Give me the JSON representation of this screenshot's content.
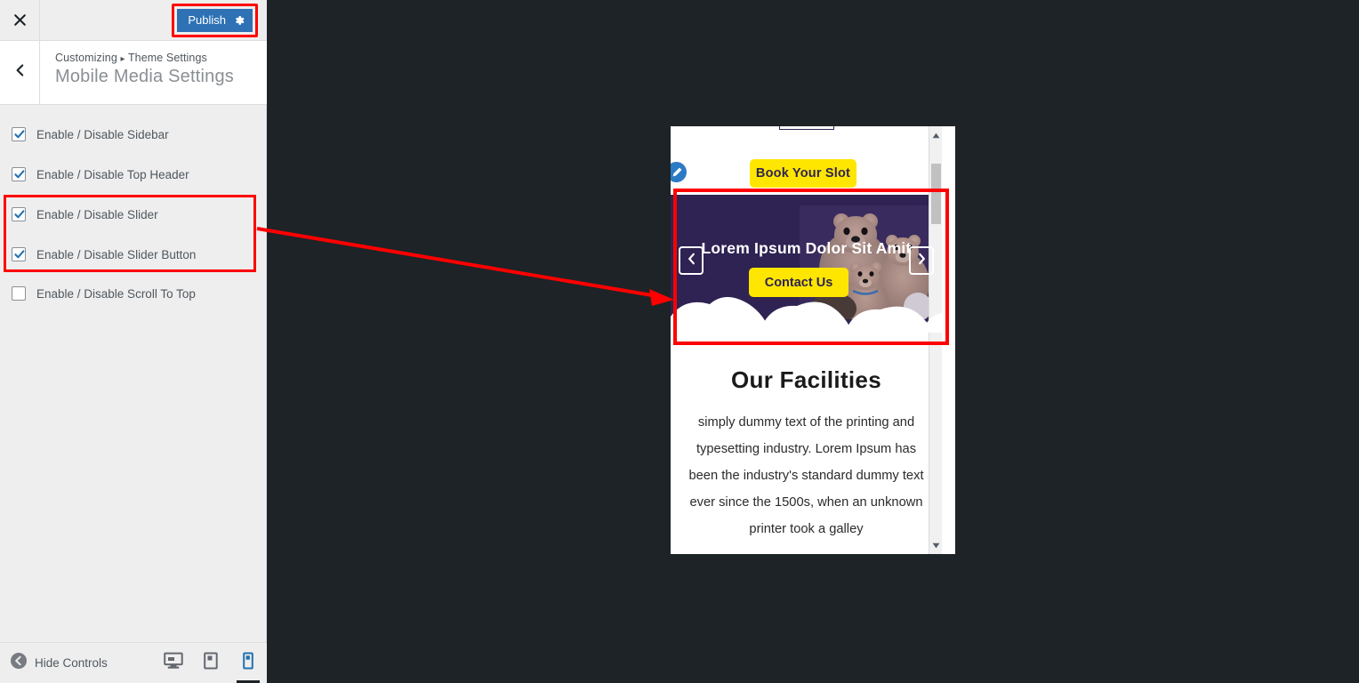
{
  "customizer": {
    "close_icon": "close-icon",
    "publish": {
      "label": "Publish",
      "gear_icon": "gear-icon",
      "color": "#2e72b5",
      "highlight_color": "#ff0000"
    },
    "back_icon": "chevron-left-icon",
    "breadcrumb": {
      "root": "Customizing",
      "separator": "▸",
      "section": "Theme Settings"
    },
    "panel_title": "Mobile Media Settings",
    "settings": [
      {
        "label": "Enable / Disable Sidebar",
        "checked": true,
        "highlighted": false
      },
      {
        "label": "Enable / Disable Top Header",
        "checked": true,
        "highlighted": false
      },
      {
        "label": "Enable / Disable Slider",
        "checked": true,
        "highlighted": true
      },
      {
        "label": "Enable / Disable Slider Button",
        "checked": true,
        "highlighted": true
      },
      {
        "label": "Enable / Disable Scroll To Top",
        "checked": false,
        "highlighted": false
      }
    ],
    "footer": {
      "hide_controls_label": "Hide Controls",
      "hide_controls_icon": "collapse-left-icon",
      "devices": [
        {
          "name": "desktop",
          "icon": "desktop-icon",
          "active": false
        },
        {
          "name": "tablet",
          "icon": "tablet-icon",
          "active": false
        },
        {
          "name": "mobile",
          "icon": "mobile-icon",
          "active": true
        }
      ]
    }
  },
  "preview": {
    "device": "mobile",
    "edit_icon": "pencil-edit-icon",
    "book_slot_label": "Book Your Slot",
    "slider": {
      "title": "Lorem Ipsum Dolor Sit Amit",
      "cta_label": "Contact Us",
      "prev_icon": "chevron-left-icon",
      "next_icon": "chevron-right-icon",
      "background_color": "#2e2352",
      "accent_color": "#ffe600",
      "image_alt": "teddy-bears-photo"
    },
    "facilities": {
      "heading": "Our Facilities",
      "body": "simply dummy text of the printing and typesetting industry. Lorem Ipsum has been the industry's standard dummy text ever since the 1500s, when an unknown printer took a galley"
    },
    "scrollbar": {
      "up_icon": "scroll-up-icon",
      "down_icon": "scroll-down-icon"
    }
  },
  "annotations": {
    "highlight_color": "#ff0000",
    "arrow": "points from Slider settings to the slider region in the preview"
  }
}
